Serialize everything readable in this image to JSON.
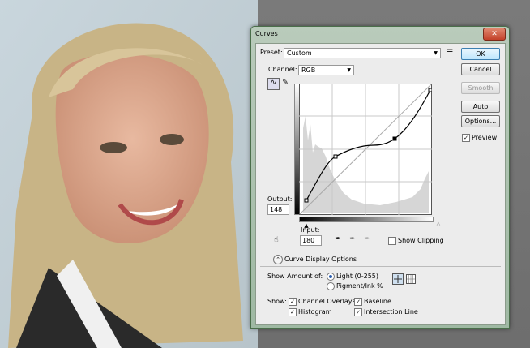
{
  "dialog": {
    "title": "Curves",
    "close_glyph": "✕",
    "preset_label": "Preset:",
    "preset_value": "Custom",
    "channel_label": "Channel:",
    "channel_value": "RGB",
    "output_label": "Output:",
    "output_value": "148",
    "input_label": "Input:",
    "input_value": "180",
    "show_clipping_label": "Show Clipping",
    "display_options_label": "Curve Display Options",
    "show_amount_label": "Show Amount of:",
    "light_label": "Light  (0-255)",
    "pigment_label": "Pigment/Ink %",
    "show_label": "Show:",
    "channel_overlays_label": "Channel Overlays",
    "baseline_label": "Baseline",
    "histogram_label": "Histogram",
    "intersection_label": "Intersection Line",
    "checkmark": "✓"
  },
  "buttons": {
    "ok": "OK",
    "cancel": "Cancel",
    "smooth": "Smooth",
    "auto": "Auto",
    "options": "Options...",
    "preview": "Preview"
  },
  "state": {
    "light_selected": true,
    "preview_checked": true,
    "show_clipping_checked": false,
    "channel_overlays_checked": true,
    "baseline_checked": true,
    "histogram_checked": true,
    "intersection_checked": true
  },
  "icons": {
    "preset_menu": "preset-menu-icon",
    "curve_tool": "curve-point-tool-icon",
    "pencil_tool": "pencil-icon",
    "hand_tool": "on-image-adjust-icon",
    "black_eyedropper": "black-point-eyedropper-icon",
    "gray_eyedropper": "gray-point-eyedropper-icon",
    "white_eyedropper": "white-point-eyedropper-icon",
    "expand": "chevron-up-icon",
    "grid_small": "grid-4x4-icon",
    "grid_large": "grid-10x10-icon"
  },
  "colors": {
    "window_frame": "#9fb9a3",
    "client_bg": "#ececec",
    "ok_accent": "#bee6fd",
    "close_red": "#c3412a"
  }
}
